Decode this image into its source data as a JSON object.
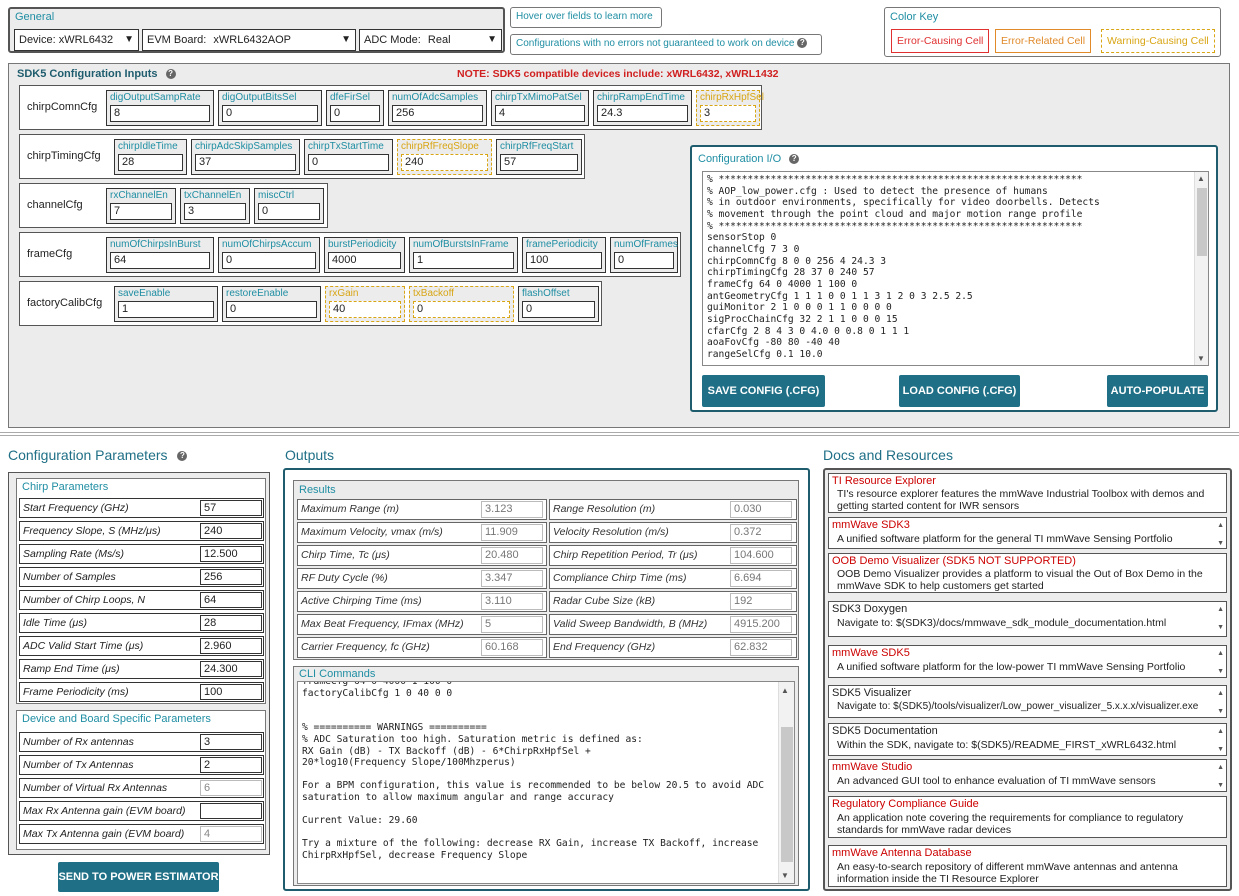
{
  "general": {
    "title": "General",
    "device_label": "Device:",
    "device_value": "xWRL6432",
    "evm_label": "EVM Board:",
    "evm_value": "xWRL6432AOP",
    "adc_label": "ADC Mode:",
    "adc_value": "Real"
  },
  "hints": {
    "hover": "Hover over fields to learn more",
    "no_errors": "Configurations with no errors not guaranteed to work on device"
  },
  "color_key": {
    "title": "Color Key",
    "error": "Error-Causing Cell",
    "related": "Error-Related Cell",
    "warning": "Warning-Causing Cell",
    "error_color": "#e03030",
    "related_color": "#e08a2a",
    "warning_color": "#d8a514"
  },
  "sdk5": {
    "title": "SDK5 Configuration Inputs",
    "note": "NOTE: SDK5 compatible devices include: xWRL6432, xWRL1432",
    "rows": [
      {
        "name": "chirpComnCfg",
        "fields": [
          {
            "label": "digOutputSampRate",
            "value": "8"
          },
          {
            "label": "digOutputBitsSel",
            "value": "0"
          },
          {
            "label": "dfeFirSel",
            "value": "0"
          },
          {
            "label": "numOfAdcSamples",
            "value": "256"
          },
          {
            "label": "chirpTxMimoPatSel",
            "value": "4"
          },
          {
            "label": "chirpRampEndTime",
            "value": "24.3"
          },
          {
            "label": "chirpRxHpfSel",
            "value": "3"
          }
        ]
      },
      {
        "name": "chirpTimingCfg",
        "fields": [
          {
            "label": "chirpIdleTime",
            "value": "28"
          },
          {
            "label": "chirpAdcSkipSamples",
            "value": "37"
          },
          {
            "label": "chirpTxStartTime",
            "value": "0"
          },
          {
            "label": "chirpRfFreqSlope",
            "value": "240"
          },
          {
            "label": "chirpRfFreqStart",
            "value": "57"
          }
        ]
      },
      {
        "name": "channelCfg",
        "fields": [
          {
            "label": "rxChannelEn",
            "value": "7"
          },
          {
            "label": "txChannelEn",
            "value": "3"
          },
          {
            "label": "miscCtrl",
            "value": "0"
          }
        ]
      },
      {
        "name": "frameCfg",
        "fields": [
          {
            "label": "numOfChirpsInBurst",
            "value": "64"
          },
          {
            "label": "numOfChirpsAccum",
            "value": "0"
          },
          {
            "label": "burstPeriodicity",
            "value": "4000"
          },
          {
            "label": "numOfBurstsInFrame",
            "value": "1"
          },
          {
            "label": "framePeriodicity",
            "value": "100"
          },
          {
            "label": "numOfFrames",
            "value": "0"
          }
        ]
      },
      {
        "name": "factoryCalibCfg",
        "fields": [
          {
            "label": "saveEnable",
            "value": "1"
          },
          {
            "label": "restoreEnable",
            "value": "0"
          },
          {
            "label": "rxGain",
            "value": "40"
          },
          {
            "label": "txBackoff",
            "value": "0"
          },
          {
            "label": "flashOffset",
            "value": "0"
          }
        ]
      }
    ]
  },
  "config_io": {
    "title": "Configuration I/O",
    "text": "% ***************************************************************\n% AOP_low_power.cfg : Used to detect the presence of humans\n% in outdoor environments, specifically for video doorbells. Detects\n% movement through the point cloud and major motion range profile\n% ***************************************************************\nsensorStop 0\nchannelCfg 7 3 0\nchirpComnCfg 8 0 0 256 4 24.3 3\nchirpTimingCfg 28 37 0 240 57\nframeCfg 64 0 4000 1 100 0\nantGeometryCfg 1 1 1 0 0 1 1 3 1 2 0 3 2.5 2.5\nguiMonitor 2 1 0 0 0 1 1 0 0 0 0\nsigProcChainCfg 32 2 1 1 0 0 0 15\ncfarCfg 2 8 4 3 0 4.0 0 0.8 0 1 1 1\naoaFovCfg -80 80 -40 40\nrangeSelCfg 0.1 10.0",
    "save_btn": "SAVE CONFIG (.CFG)",
    "load_btn": "LOAD CONFIG (.CFG)",
    "auto_btn": "AUTO-POPULATE"
  },
  "config_params": {
    "title": "Configuration Parameters",
    "chirp_title": "Chirp Parameters",
    "chirp": [
      {
        "label": "Start Frequency (GHz)",
        "value": "57"
      },
      {
        "label": "Frequency Slope, S (MHz/μs)",
        "value": "240"
      },
      {
        "label": "Sampling Rate (Ms/s)",
        "value": "12.500"
      },
      {
        "label": "Number of Samples",
        "value": "256"
      },
      {
        "label": "Number of Chirp Loops, N",
        "value": "64"
      },
      {
        "label": "Idle Time (μs)",
        "value": "28"
      },
      {
        "label": "ADC Valid Start Time (μs)",
        "value": "2.960"
      },
      {
        "label": "Ramp End Time (μs)",
        "value": "24.300"
      },
      {
        "label": "Frame Periodicity (ms)",
        "value": "100"
      }
    ],
    "device_title": "Device and Board Specific Parameters",
    "device": [
      {
        "label": "Number of Rx antennas",
        "value": "3"
      },
      {
        "label": "Number of Tx Antennas",
        "value": "2"
      },
      {
        "label": "Number of Virtual Rx Antennas",
        "value": "6"
      },
      {
        "label": "Max Rx Antenna gain (EVM board)",
        "value": ""
      },
      {
        "label": "Max Tx Antenna gain (EVM board)",
        "value": "4"
      }
    ],
    "send_btn": "SEND TO POWER ESTIMATOR"
  },
  "outputs": {
    "title": "Outputs",
    "results_title": "Results",
    "left": [
      {
        "label": "Maximum Range (m)",
        "value": "3.123"
      },
      {
        "label": "Maximum Velocity, vmax (m/s)",
        "value": "11.909"
      },
      {
        "label": "Chirp Time, Tc (μs)",
        "value": "20.480"
      },
      {
        "label": "RF Duty Cycle (%)",
        "value": "3.347"
      },
      {
        "label": "Active Chirping Time (ms)",
        "value": "3.110"
      },
      {
        "label": "Max Beat Frequency, IFmax (MHz)",
        "value": "5"
      },
      {
        "label": "Carrier Frequency, fc (GHz)",
        "value": "60.168"
      }
    ],
    "right": [
      {
        "label": "Range Resolution (m)",
        "value": "0.030"
      },
      {
        "label": "Velocity Resolution (m/s)",
        "value": "0.372"
      },
      {
        "label": "Chirp Repetition Period, Tr (μs)",
        "value": "104.600"
      },
      {
        "label": "Compliance Chirp Time (ms)",
        "value": "6.694"
      },
      {
        "label": "Radar Cube Size (kB)",
        "value": "192"
      },
      {
        "label": "Valid Sweep Bandwidth, B (MHz)",
        "value": "4915.200"
      },
      {
        "label": "End Frequency (GHz)",
        "value": "62.832"
      }
    ],
    "cli_title": "CLI Commands",
    "cli_text": "frameCfg 64 0 4000 1 100 0\nfactoryCalibCfg 1 0 40 0 0\n\n\n% ========== WARNINGS ==========\n% ADC Saturation too high. Saturation metric is defined as:\nRX Gain (dB) - TX Backoff (dB) - 6*ChirpRxHpfSel +\n20*log10(Frequency Slope/100Mhzperus)\n\nFor a BPM configuration, this value is recommended to be below 20.5 to avoid ADC\nsaturation to allow maximum angular and range accuracy\n\nCurrent Value: 29.60\n\nTry a mixture of the following: decrease RX Gain, increase TX Backoff, increase\nChirpRxHpfSel, decrease Frequency Slope"
  },
  "docs": {
    "title": "Docs and Resources",
    "items": [
      {
        "title": "TI Resource Explorer",
        "desc": "TI's resource explorer features the mmWave Industrial Toolbox with demos and getting started content for IWR sensors",
        "red": true,
        "italic": false
      },
      {
        "title": "mmWave SDK3",
        "desc": "A unified software platform for the general TI mmWave Sensing Portfolio",
        "red": true,
        "italic": false
      },
      {
        "title": "OOB Demo Visualizer (SDK5 NOT SUPPORTED)",
        "desc": "OOB Demo Visualizer provides a platform to visual the Out of Box Demo in the mmWave SDK to help customers get started",
        "red": true,
        "italic": false
      },
      {
        "title": "SDK3 Doxygen",
        "desc": "Navigate to:  $(SDK3)/docs/mmwave_sdk_module_documentation.html",
        "red": false,
        "italic": true
      },
      {
        "title": "mmWave SDK5",
        "desc": "A unified software platform for the low-power TI mmWave Sensing Portfolio",
        "red": true,
        "italic": false
      },
      {
        "title": "SDK5 Visualizer",
        "desc": "Navigate to:  $(SDK5)/tools/visualizer/Low_power_visualizer_5.x.x.x/visualizer.exe",
        "red": false,
        "italic": true
      },
      {
        "title": "SDK5 Documentation",
        "desc": "Within the SDK, navigate to:  $(SDK5)/README_FIRST_xWRL6432.html",
        "red": false,
        "italic": true
      },
      {
        "title": "mmWave Studio",
        "desc": "An advanced GUI tool to enhance evaluation of TI mmWave sensors",
        "red": true,
        "italic": false
      },
      {
        "title": "Regulatory Compliance Guide",
        "desc": "An application note covering the requirements for compliance to regulatory standards for mmWave radar devices",
        "red": true,
        "italic": false
      },
      {
        "title": "mmWave Antenna Database",
        "desc": "An easy-to-search repository of different mmWave antennas and antenna information inside the TI Resource Explorer",
        "red": true,
        "italic": false
      }
    ]
  }
}
